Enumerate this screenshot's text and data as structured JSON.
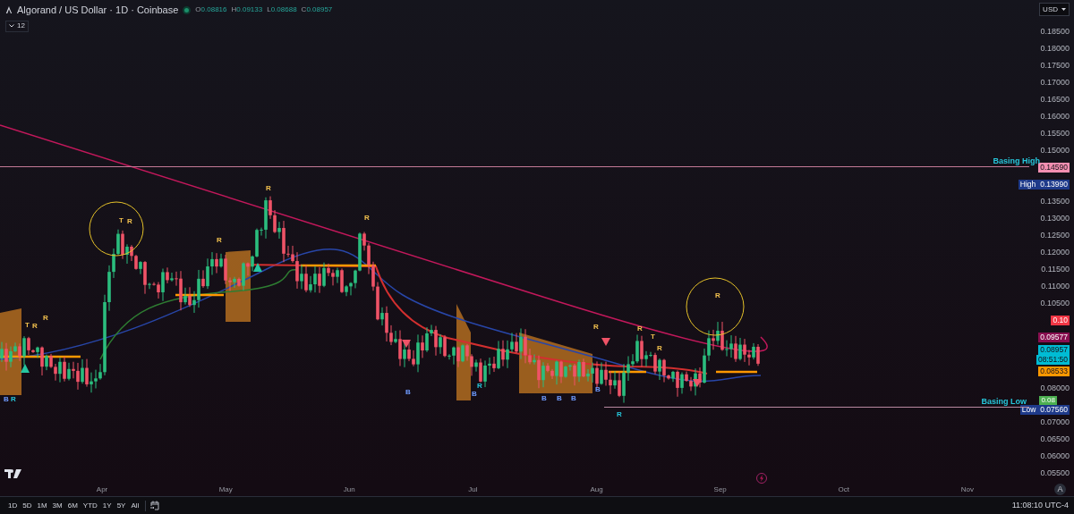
{
  "header": {
    "title": "Algorand / US Dollar · 1D · Coinbase",
    "ohlc": [
      {
        "label": "O",
        "value": "0.08816"
      },
      {
        "label": "H",
        "value": "0.09133"
      },
      {
        "label": "L",
        "value": "0.08688"
      },
      {
        "label": "C",
        "value": "0.08957"
      }
    ],
    "indicators_count": "12"
  },
  "price_scale": {
    "currency": "USD",
    "ticks": [
      {
        "kind": "tick",
        "text": "0.18500"
      },
      {
        "kind": "tick",
        "text": "0.18000"
      },
      {
        "kind": "tick",
        "text": "0.17500"
      },
      {
        "kind": "tick",
        "text": "0.17000"
      },
      {
        "kind": "tick",
        "text": "0.16500"
      },
      {
        "kind": "tick",
        "text": "0.16000"
      },
      {
        "kind": "tick",
        "text": "0.15500"
      },
      {
        "kind": "tick",
        "text": "0.15000"
      },
      {
        "kind": "tag",
        "text": "0.14590",
        "color": "#f48fb1"
      },
      {
        "kind": "tag",
        "label": "High",
        "text": "0.13990",
        "color": "#1e3a8a"
      },
      {
        "kind": "tick",
        "text": "0.13500"
      },
      {
        "kind": "tick",
        "text": "0.13000"
      },
      {
        "kind": "tick",
        "text": "0.12500"
      },
      {
        "kind": "tick",
        "text": "0.12000"
      },
      {
        "kind": "tick",
        "text": "0.11500"
      },
      {
        "kind": "tick",
        "text": "0.11000"
      },
      {
        "kind": "tick",
        "text": "0.10500"
      },
      {
        "kind": "tag",
        "text": "0.10",
        "color": "#f23645"
      },
      {
        "kind": "tag",
        "text": "0.09577",
        "color": "#880e4f"
      },
      {
        "kind": "tag",
        "text": "0.08957",
        "sub": "08:51:50",
        "color": "#00bcd4"
      },
      {
        "kind": "tag",
        "text": "0.08533",
        "color": "#ff9800"
      },
      {
        "kind": "tick",
        "text": "0.08000"
      },
      {
        "kind": "tag",
        "text": "0.07560",
        "label": "Low",
        "extra": {
          "text": "0.08",
          "color": "#4caf50"
        },
        "color": "#1e3a8a"
      },
      {
        "kind": "tick",
        "text": "0.07000"
      },
      {
        "kind": "tick",
        "text": "0.06500"
      },
      {
        "kind": "tick",
        "text": "0.06000"
      },
      {
        "kind": "tick",
        "text": "0.05500"
      }
    ],
    "auto_button": "A"
  },
  "levels": [
    {
      "label": "Basing High"
    },
    {
      "label": "Basing Low"
    }
  ],
  "signals": [
    {
      "text": "T",
      "color": "#f2c14e"
    },
    {
      "text": "R",
      "color": "#f2c14e"
    },
    {
      "text": "R",
      "color": "#f2c14e"
    },
    {
      "text": "B",
      "color": "#6f9bff"
    },
    {
      "text": "R",
      "color": "#26c6da"
    },
    {
      "text": "T",
      "color": "#f2c14e"
    },
    {
      "text": "R",
      "color": "#f2c14e"
    },
    {
      "text": "R",
      "color": "#f2c14e"
    },
    {
      "text": "R",
      "color": "#f2c14e"
    },
    {
      "text": "R",
      "color": "#f2c14e"
    },
    {
      "text": "B",
      "color": "#6f9bff"
    },
    {
      "text": "R",
      "color": "#26c6da"
    },
    {
      "text": "B",
      "color": "#6f9bff"
    },
    {
      "text": "B",
      "color": "#6f9bff"
    },
    {
      "text": "B",
      "color": "#6f9bff"
    },
    {
      "text": "B",
      "color": "#6f9bff"
    },
    {
      "text": "B",
      "color": "#6f9bff"
    },
    {
      "text": "R",
      "color": "#f2c14e"
    },
    {
      "text": "R",
      "color": "#f2c14e"
    },
    {
      "text": "T",
      "color": "#f2c14e"
    },
    {
      "text": "R",
      "color": "#f2c14e"
    },
    {
      "text": "R",
      "color": "#26c6da"
    },
    {
      "text": "R",
      "color": "#f2c14e"
    }
  ],
  "time_scale": [
    "Apr",
    "May",
    "Jun",
    "Jul",
    "Aug",
    "Sep",
    "Oct",
    "Nov"
  ],
  "toolbar": {
    "ranges": [
      "1D",
      "5D",
      "1M",
      "3M",
      "6M",
      "YTD",
      "1Y",
      "5Y",
      "All"
    ],
    "clock": "11:08:10 UTC-4"
  }
}
